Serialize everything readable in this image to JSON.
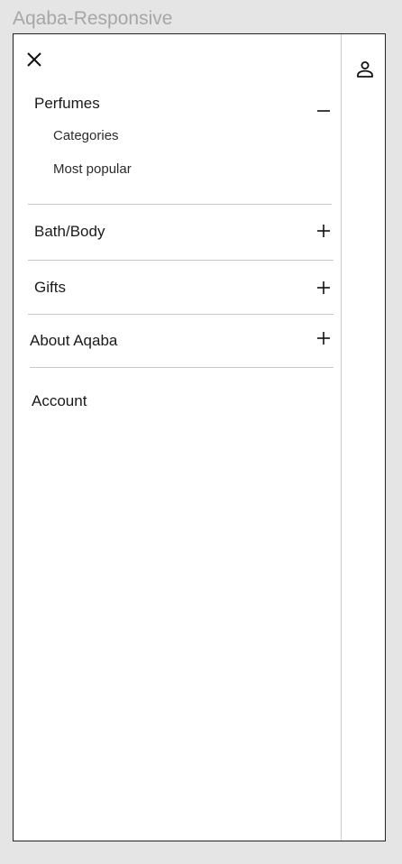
{
  "artboard": {
    "title": "Aqaba-Responsive"
  },
  "menu": {
    "close_icon": "close-icon",
    "sections": [
      {
        "label": "Perfumes",
        "expanded": true,
        "toggle_icon": "minus-icon",
        "items": [
          {
            "label": "Categories"
          },
          {
            "label": "Most popular"
          }
        ]
      },
      {
        "label": "Bath/Body",
        "expanded": false,
        "toggle_icon": "plus-icon"
      },
      {
        "label": "Gifts",
        "expanded": false,
        "toggle_icon": "plus-icon"
      },
      {
        "label": "About Aqaba",
        "expanded": false,
        "toggle_icon": "plus-icon"
      }
    ],
    "account_label": "Account"
  },
  "side_strip": {
    "user_icon": "user-icon"
  },
  "colors": {
    "canvas_background": "#e5e5e5",
    "artboard_title": "#a6a6a6",
    "frame_border": "#222222",
    "divider": "#c8c8c8",
    "text": "#1a1a1a"
  }
}
